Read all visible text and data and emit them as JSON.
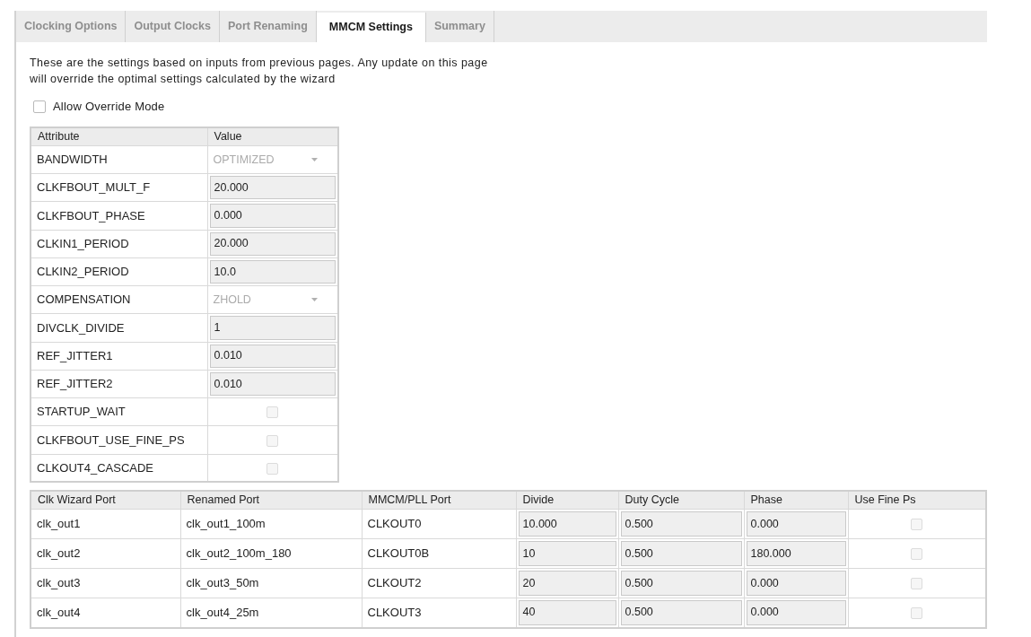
{
  "tabs": [
    {
      "label": "Clocking Options",
      "selected": false
    },
    {
      "label": "Output Clocks",
      "selected": false
    },
    {
      "label": "Port Renaming",
      "selected": false
    },
    {
      "label": "MMCM Settings",
      "selected": true
    },
    {
      "label": "Summary",
      "selected": false
    }
  ],
  "description": [
    "These are the settings based on inputs from previous pages. Any update on this page",
    "will override the optimal settings calculated by the wizard"
  ],
  "override_mode": {
    "label": "Allow Override Mode",
    "checked": false
  },
  "attribute_table": {
    "columns": [
      "Attribute",
      "Value"
    ],
    "rows": [
      {
        "attribute": "BANDWIDTH",
        "kind": "select",
        "value": "OPTIMIZED"
      },
      {
        "attribute": "CLKFBOUT_MULT_F",
        "kind": "field",
        "value": "20.000"
      },
      {
        "attribute": "CLKFBOUT_PHASE",
        "kind": "field",
        "value": "0.000"
      },
      {
        "attribute": "CLKIN1_PERIOD",
        "kind": "field",
        "value": "20.000"
      },
      {
        "attribute": "CLKIN2_PERIOD",
        "kind": "field",
        "value": "10.0"
      },
      {
        "attribute": "COMPENSATION",
        "kind": "select",
        "value": "ZHOLD"
      },
      {
        "attribute": "DIVCLK_DIVIDE",
        "kind": "field",
        "value": "1"
      },
      {
        "attribute": "REF_JITTER1",
        "kind": "field",
        "value": "0.010"
      },
      {
        "attribute": "REF_JITTER2",
        "kind": "field",
        "value": "0.010"
      },
      {
        "attribute": "STARTUP_WAIT",
        "kind": "checkbox",
        "checked": false
      },
      {
        "attribute": "CLKFBOUT_USE_FINE_PS",
        "kind": "checkbox",
        "checked": false
      },
      {
        "attribute": "CLKOUT4_CASCADE",
        "kind": "checkbox",
        "checked": false
      }
    ]
  },
  "output_table": {
    "columns": [
      "Clk Wizard Port",
      "Renamed Port",
      "MMCM/PLL Port",
      "Divide",
      "Duty Cycle",
      "Phase",
      "Use Fine Ps"
    ],
    "rows": [
      {
        "clk_wizard_port": "clk_out1",
        "renamed_port": "clk_out1_100m",
        "mmcm_pll_port": "CLKOUT0",
        "divide": "10.000",
        "duty_cycle": "0.500",
        "phase": "0.000",
        "use_fine_ps": {
          "checked": false
        }
      },
      {
        "clk_wizard_port": "clk_out2",
        "renamed_port": "clk_out2_100m_180",
        "mmcm_pll_port": "CLKOUT0B",
        "divide": "10",
        "duty_cycle": "0.500",
        "phase": "180.000",
        "use_fine_ps": {
          "checked": false
        }
      },
      {
        "clk_wizard_port": "clk_out3",
        "renamed_port": "clk_out3_50m",
        "mmcm_pll_port": "CLKOUT2",
        "divide": "20",
        "duty_cycle": "0.500",
        "phase": "0.000",
        "use_fine_ps": {
          "checked": false
        }
      },
      {
        "clk_wizard_port": "clk_out4",
        "renamed_port": "clk_out4_25m",
        "mmcm_pll_port": "CLKOUT3",
        "divide": "40",
        "duty_cycle": "0.500",
        "phase": "0.000",
        "use_fine_ps": {
          "checked": false
        }
      }
    ]
  }
}
